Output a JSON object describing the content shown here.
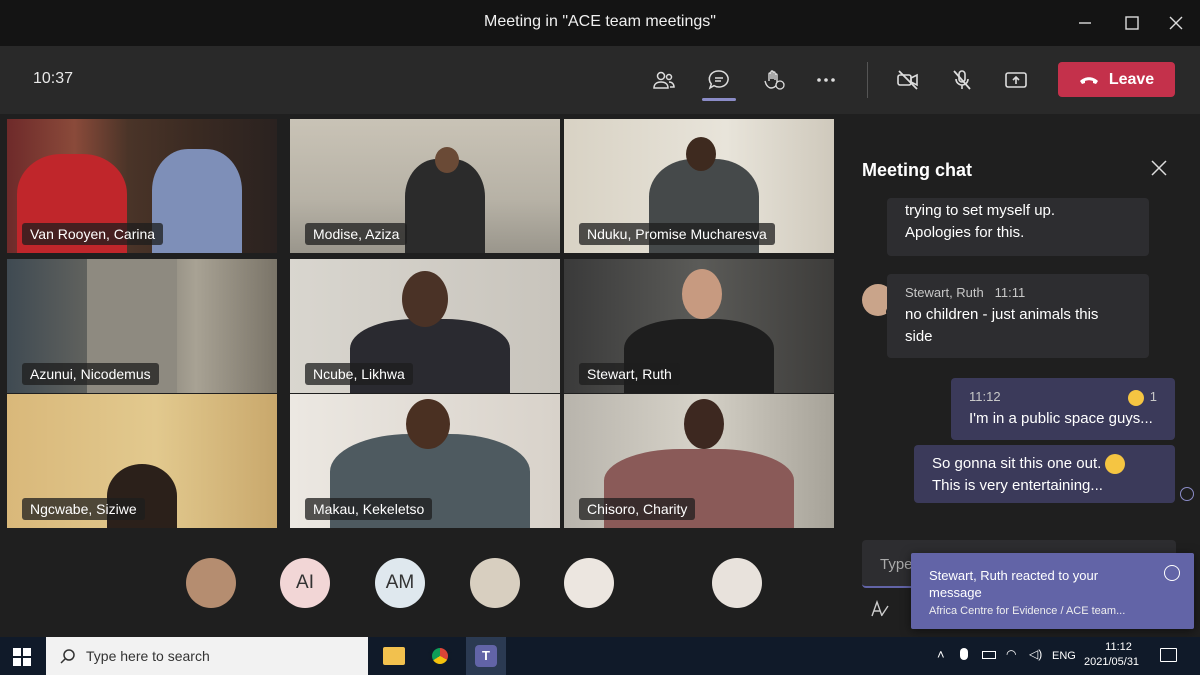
{
  "window": {
    "title": "Meeting in \"ACE team meetings\""
  },
  "toolbar": {
    "time": "10:37",
    "leave_label": "Leave"
  },
  "participants": [
    {
      "name": "Van Rooyen, Carina"
    },
    {
      "name": "Modise, Aziza"
    },
    {
      "name": "Nduku, Promise Mucharesva"
    },
    {
      "name": "Azunui, Nicodemus"
    },
    {
      "name": "Ncube, Likhwa"
    },
    {
      "name": "Stewart, Ruth"
    },
    {
      "name": "Ngcwabe, Siziwe"
    },
    {
      "name": "Makau, Kekeletso"
    },
    {
      "name": "Chisoro, Charity"
    }
  ],
  "avatars": [
    {
      "initials": ""
    },
    {
      "initials": "AI"
    },
    {
      "initials": "AM"
    },
    {
      "initials": ""
    },
    {
      "initials": ""
    },
    {
      "initials": ""
    }
  ],
  "chat": {
    "title": "Meeting chat",
    "messages": [
      {
        "line1": "trying to set myself up.",
        "line2": "Apologies for this."
      },
      {
        "author": "Stewart, Ruth",
        "time": "11:11",
        "line1": "no children - just animals this",
        "line2": "side"
      },
      {
        "time": "11:12",
        "reaction_count": "1",
        "text": "I'm in a public space guys..."
      },
      {
        "line1": "So gonna sit this one out.",
        "line2": "This is very entertaining..."
      }
    ],
    "compose_placeholder": "Type"
  },
  "toast": {
    "line1": "Stewart, Ruth reacted to your message",
    "line2": "Africa Centre for Evidence / ACE team..."
  },
  "taskbar": {
    "search_placeholder": "Type here to search",
    "lang": "ENG",
    "time": "11:12",
    "date": "2021/05/31"
  }
}
